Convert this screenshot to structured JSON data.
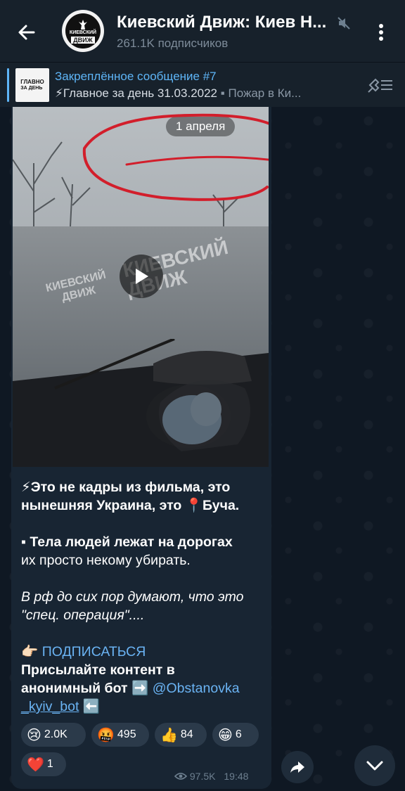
{
  "header": {
    "title": "Киевский Движ: Киев Н...",
    "subtitle": "261.1K подписчиков",
    "avatar_text_1": "КИЕВСКИЙ",
    "avatar_text_2": "ДВИЖ"
  },
  "pinned": {
    "title": "Закреплённое сообщение #7",
    "preview_main": "⚡Главное за день 31.03.2022",
    "preview_rest": " ▪ Пожар в Ки...",
    "thumb_text_1": "ГЛАВНО",
    "thumb_text_2": "ЗА ДЕНЬ"
  },
  "video": {
    "date_label": "1 апреля",
    "watermark": "КИЕВСКИЙ ДВИЖ",
    "watermark_logo_1": "КИЕВСКИЙ",
    "watermark_logo_2": "ДВИЖ"
  },
  "message": {
    "line1": "⚡Это не кадры из фильма, это",
    "line2": "нынешняя Украина, это 📍Буча.",
    "line3": "▪ Тела людей лежат на дорогах",
    "line4": "их просто некому убирать.",
    "line5": "В рф до сих пор думают, что это",
    "line6": "\"спец. операция\"....",
    "subscribe_prefix": "👉🏻 ",
    "subscribe": "ПОДПИСАТЬСЯ",
    "line8": "Присылайте контент в",
    "line9_text": "анонимный бот ➡️ ",
    "line9_link": "@Obstanovka",
    "line10_link": "_kyiv_bot",
    "line10_suffix": " ⬅️"
  },
  "reactions": [
    {
      "emoji": "😢",
      "count": "2.0K"
    },
    {
      "emoji": "🤬",
      "count": "495"
    },
    {
      "emoji": "👍",
      "count": "84"
    },
    {
      "emoji": "😁",
      "count": "6"
    },
    {
      "emoji": "❤️",
      "count": "1"
    }
  ],
  "meta": {
    "views": "97.5K",
    "time": "19:48"
  },
  "icons": [
    "back-arrow-icon",
    "mute-icon",
    "more-vertical-icon",
    "unpin-icon",
    "play-icon",
    "eye-icon",
    "share-icon",
    "chevron-down-icon"
  ],
  "colors": {
    "accent": "#5eb5f7",
    "link": "#6ab3f3",
    "header_bg": "#17212b",
    "bubble_bg": "#182533",
    "annotation": "#d21e2b"
  }
}
